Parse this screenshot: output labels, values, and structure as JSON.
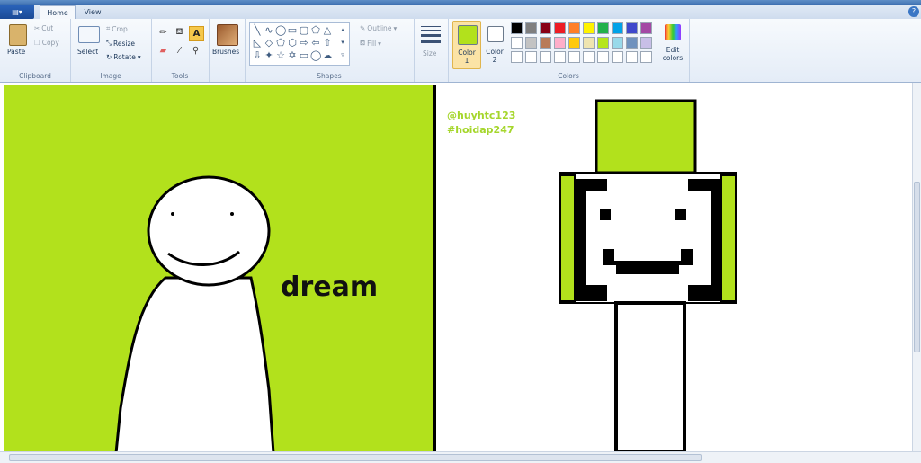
{
  "tabs": {
    "home": "Home",
    "view": "View"
  },
  "help_glyph": "?",
  "clipboard": {
    "paste": "Paste",
    "cut": "Cut",
    "copy": "Copy",
    "label": "Clipboard"
  },
  "image": {
    "select": "Select",
    "crop": "Crop",
    "resize": "Resize",
    "rotate": "Rotate",
    "label": "Image"
  },
  "tools": {
    "label": "Tools"
  },
  "brushes": {
    "label": "Brushes"
  },
  "shapes": {
    "outline": "Outline",
    "fill": "Fill",
    "label": "Shapes"
  },
  "size": {
    "label": "Size"
  },
  "colors": {
    "color1": "Color 1",
    "color1_line1": "Color",
    "color1_line2": "1",
    "color2_line1": "Color",
    "color2_line2": "2",
    "edit_line1": "Edit",
    "edit_line2": "colors",
    "label": "Colors",
    "color1_value": "#b2e11c",
    "color2_value": "#ffffff",
    "palette_row1": [
      "#000000",
      "#7f7f7f",
      "#880015",
      "#ed1c24",
      "#ff7f27",
      "#fff200",
      "#22b14c",
      "#00a2e8",
      "#3f48cc",
      "#a349a4"
    ],
    "palette_row2": [
      "#ffffff",
      "#c3c3c3",
      "#b97a57",
      "#ffaec9",
      "#ffc90e",
      "#efe4b0",
      "#b5e61d",
      "#99d9ea",
      "#7092be",
      "#c8bfe7"
    ]
  },
  "canvas": {
    "background_left": "#b2e11c",
    "caption": "dream",
    "watermark_1": "@huyhtc123",
    "watermark_2": "#hoidap247"
  }
}
